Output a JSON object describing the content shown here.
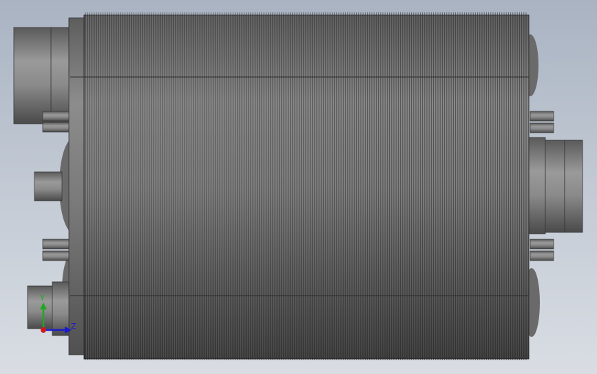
{
  "viewport": {
    "background_top": "#a9b3c2",
    "background_bottom": "#d9dde3"
  },
  "model": {
    "fin_color_light": "#8a8a8a",
    "fin_color_dark": "#3a3a3a",
    "body_color": "#6c6c6c"
  },
  "triad": {
    "y_label": "Y",
    "z_label": "Z",
    "y_color": "#1fa81f",
    "z_color": "#1a1acc",
    "x_color": "#cc1a1a"
  }
}
